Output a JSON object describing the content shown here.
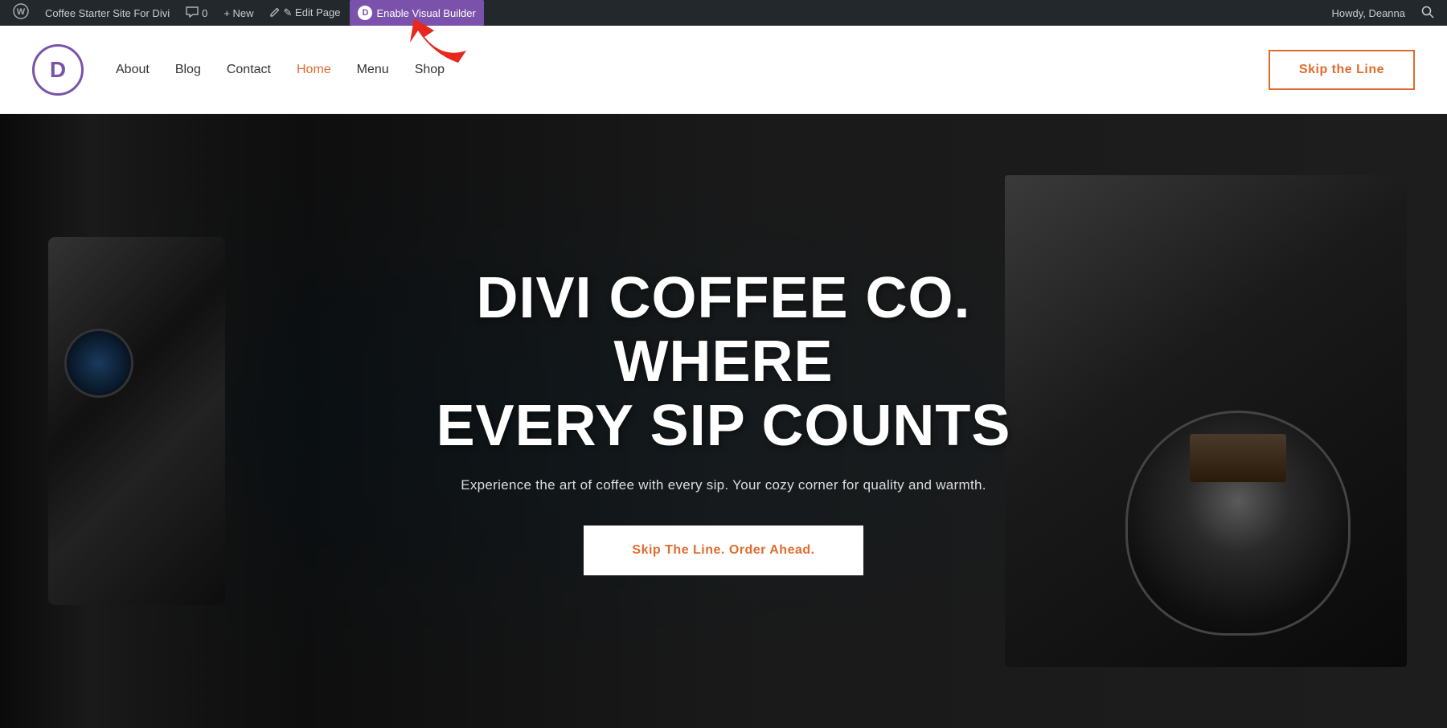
{
  "adminbar": {
    "wp_icon": "⊞",
    "site_name": "Coffee Starter Site For Divi",
    "comments_icon": "💬",
    "comments_count": "0",
    "new_label": "+ New",
    "edit_page_label": "✎ Edit Page",
    "divi_icon": "D",
    "divi_label": "Enable Visual Builder",
    "howdy_label": "Howdy, Deanna",
    "search_icon": "🔍"
  },
  "header": {
    "logo_letter": "D",
    "nav_items": [
      {
        "label": "About",
        "active": false
      },
      {
        "label": "Blog",
        "active": false
      },
      {
        "label": "Contact",
        "active": false
      },
      {
        "label": "Home",
        "active": true
      },
      {
        "label": "Menu",
        "active": false
      },
      {
        "label": "Shop",
        "active": false
      }
    ],
    "cta_label": "Skip the Line"
  },
  "hero": {
    "title_line1": "DIVI COFFEE CO. WHERE",
    "title_line2": "EVERY SIP COUNTS",
    "subtitle": "Experience the art of coffee with every sip. Your cozy corner for quality and warmth.",
    "cta_label": "Skip The Line. Order Ahead."
  }
}
